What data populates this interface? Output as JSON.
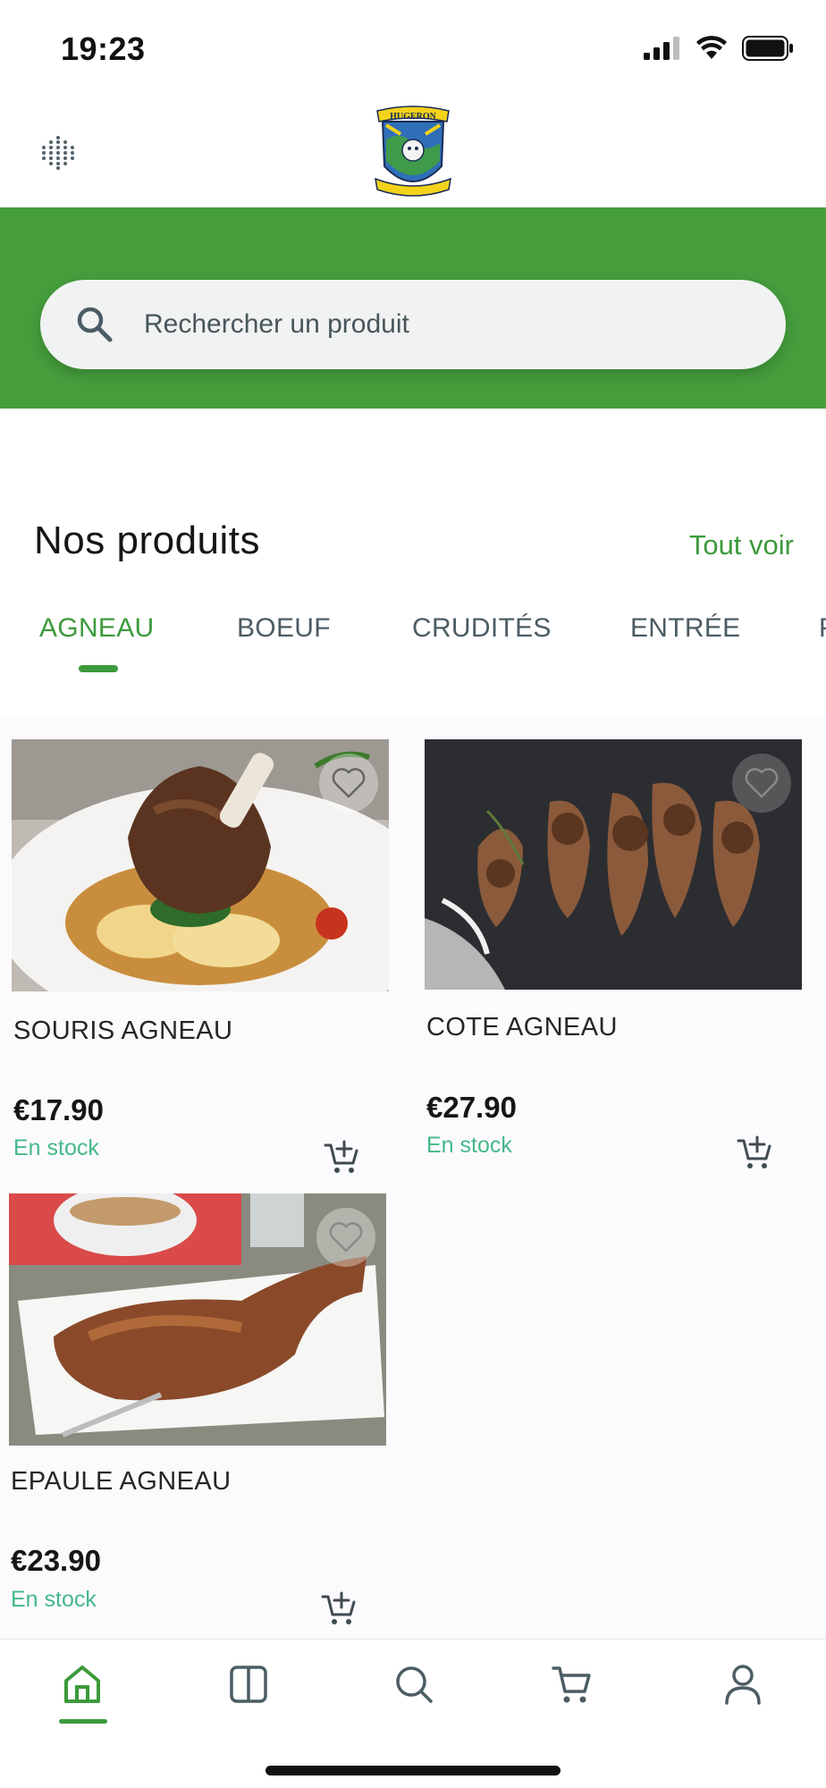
{
  "status_bar": {
    "time": "19:23"
  },
  "header": {
    "logo_text": "HUGERON"
  },
  "search": {
    "placeholder": "Rechercher un produit"
  },
  "section": {
    "title": "Nos produits",
    "see_all_label": "Tout voir"
  },
  "tabs": [
    {
      "label": "AGNEAU",
      "active": true
    },
    {
      "label": "BOEUF",
      "active": false
    },
    {
      "label": "CRUDITÉS",
      "active": false
    },
    {
      "label": "ENTRÉE",
      "active": false
    },
    {
      "label": "P",
      "active": false
    }
  ],
  "products": [
    {
      "name": "SOURIS AGNEAU",
      "price": "€17.90",
      "stock": "En stock"
    },
    {
      "name": "COTE AGNEAU",
      "price": "€27.90",
      "stock": "En stock"
    },
    {
      "name": "EPAULE AGNEAU",
      "price": "€23.90",
      "stock": "En stock"
    }
  ],
  "bottom_nav": [
    {
      "icon": "home-icon",
      "active": true
    },
    {
      "icon": "catalog-icon",
      "active": false
    },
    {
      "icon": "search-icon",
      "active": false
    },
    {
      "icon": "cart-icon",
      "active": false
    },
    {
      "icon": "profile-icon",
      "active": false
    }
  ],
  "colors": {
    "brand_green": "#459d3c",
    "accent_green": "#3c9a3b",
    "stock_green": "#46b888",
    "tab_grey": "#4b5c64"
  }
}
